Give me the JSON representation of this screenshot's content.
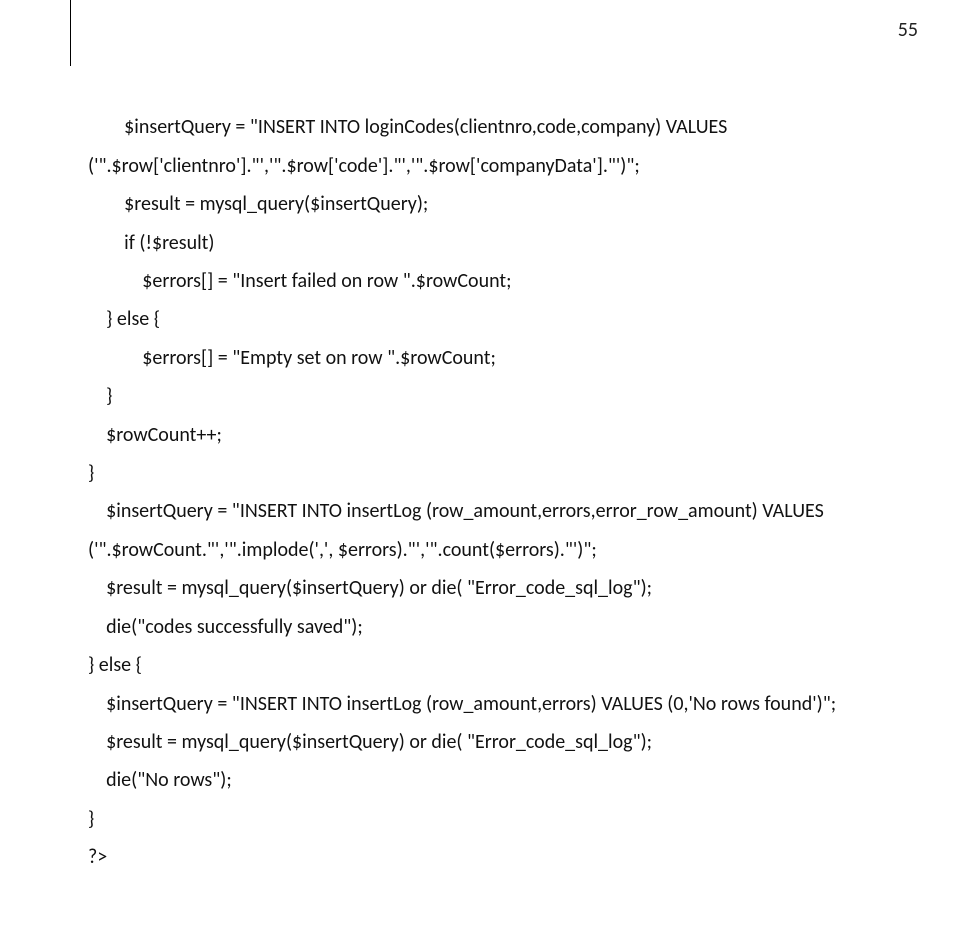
{
  "page_number": "55",
  "code": {
    "l1": "        $insertQuery = \"INSERT INTO loginCodes(clientnro,code,company) VALUES",
    "l2": "('\".$row['clientnro'].\"','\".$row['code'].\"','\".$row['companyData'].\"')\";",
    "l3": "        $result = mysql_query($insertQuery);",
    "l4": "        if (!$result)",
    "l5": "            $errors[] = \"Insert failed on row \".$rowCount;",
    "l6": "    } else {",
    "l7": "            $errors[] = \"Empty set on row \".$rowCount;",
    "l8": "    }",
    "l9": "    $rowCount++;",
    "l10": "}",
    "l11": "    $insertQuery = \"INSERT INTO insertLog (row_amount,errors,error_row_amount) VALUES",
    "l12": "('\".$rowCount.\"','\".implode(',', $errors).\"','\".count($errors).\"')\";",
    "l13": "    $result = mysql_query($insertQuery) or die( \"Error_code_sql_log\");",
    "l14": "    die(\"codes successfully saved\");",
    "l15": "} else {",
    "l16": "    $insertQuery = \"INSERT INTO insertLog (row_amount,errors) VALUES (0,'No rows found')\";",
    "l17": "    $result = mysql_query($insertQuery) or die( \"Error_code_sql_log\");",
    "l18": "    die(\"No rows\");",
    "l19": "}",
    "l20": "?>"
  }
}
